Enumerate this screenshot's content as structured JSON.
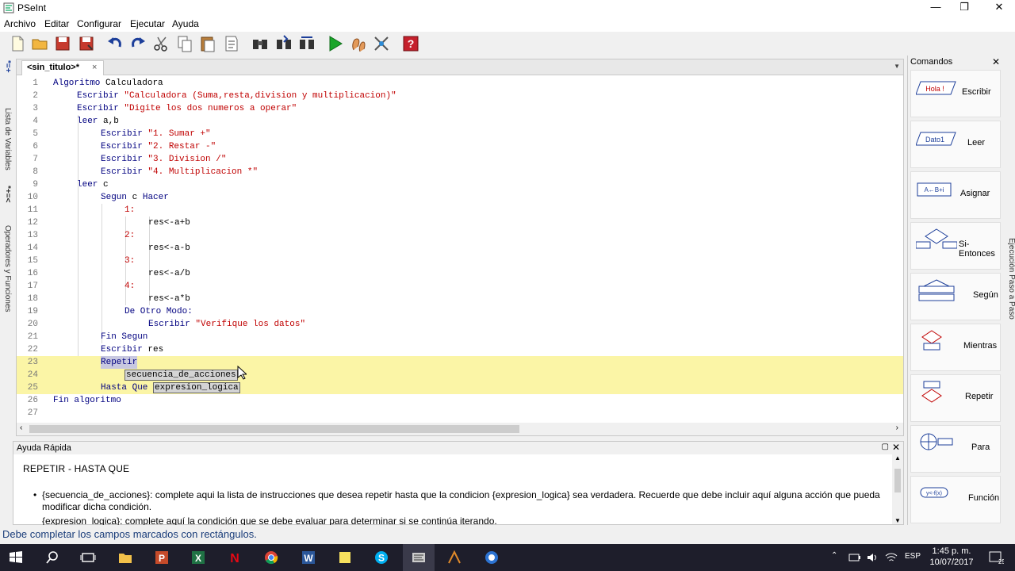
{
  "window": {
    "title": "PSeInt"
  },
  "menu": [
    "Archivo",
    "Editar",
    "Configurar",
    "Ejecutar",
    "Ayuda"
  ],
  "left_tabs": {
    "variables": "Lista de Variables",
    "operators": "Operadores y Funciones",
    "icons_top": "*=+",
    "icons_mid": "*+=<"
  },
  "editor": {
    "tab_label": "<sin_titulo>*",
    "tab_close": "×",
    "lines": [
      {
        "n": "1",
        "text": "Algoritmo Calculadora"
      },
      {
        "n": "2",
        "text": "Escribir \"Calculadora (Suma,resta,division y multiplicacion)\""
      },
      {
        "n": "3",
        "text": "Escribir \"Digite los dos numeros a operar\""
      },
      {
        "n": "4",
        "text": "leer a,b"
      },
      {
        "n": "5",
        "text": "Escribir \"1. Sumar +\""
      },
      {
        "n": "6",
        "text": "Escribir \"2. Restar -\""
      },
      {
        "n": "7",
        "text": "Escribir \"3. Division /\""
      },
      {
        "n": "8",
        "text": "Escribir \"4. Multiplicacion *\""
      },
      {
        "n": "9",
        "text": "leer c"
      },
      {
        "n": "10",
        "text": "Segun c Hacer"
      },
      {
        "n": "11",
        "text": "1:"
      },
      {
        "n": "12",
        "text": "res<-a+b"
      },
      {
        "n": "13",
        "text": "2:"
      },
      {
        "n": "14",
        "text": "res<-a-b"
      },
      {
        "n": "15",
        "text": "3:"
      },
      {
        "n": "16",
        "text": "res<-a/b"
      },
      {
        "n": "17",
        "text": "4:"
      },
      {
        "n": "18",
        "text": "res<-a*b"
      },
      {
        "n": "19",
        "text": "De Otro Modo:"
      },
      {
        "n": "20",
        "text": "Escribir \"Verifique los datos\""
      },
      {
        "n": "21",
        "text": "Fin Segun"
      },
      {
        "n": "22",
        "text": "Escribir res"
      },
      {
        "n": "23",
        "text": "Repetir"
      },
      {
        "n": "24",
        "text": "secuencia_de_acciones"
      },
      {
        "n": "25",
        "text": "Hasta Que expresion_logica"
      },
      {
        "n": "26",
        "text": "Fin algoritmo"
      },
      {
        "n": "27",
        "text": ""
      }
    ],
    "tokens": {
      "l1_kw": "Algoritmo",
      "l1_id": "Calculadora",
      "l2_kw": "Escribir",
      "l2_str": "\"Calculadora (Suma,resta,division y multiplicacion)\"",
      "l3_kw": "Escribir",
      "l3_str": "\"Digite los dos numeros a operar\"",
      "l4_kw": "leer",
      "l4_id": "a,b",
      "l5_kw": "Escribir",
      "l5_str": "\"1. Sumar +\"",
      "l6_kw": "Escribir",
      "l6_str": "\"2. Restar -\"",
      "l7_kw": "Escribir",
      "l7_str": "\"3. Division /\"",
      "l8_kw": "Escribir",
      "l8_str": "\"4. Multiplicacion *\"",
      "l9_kw": "leer",
      "l9_id": "c",
      "l10_kw1": "Segun",
      "l10_id": "c",
      "l10_kw2": "Hacer",
      "l11": "1:",
      "l12": "res<-a+b",
      "l13": "2:",
      "l14": "res<-a-b",
      "l15": "3:",
      "l16": "res<-a/b",
      "l17": "4:",
      "l18": "res<-a*b",
      "l19_kw": "De Otro Modo:",
      "l20_kw": "Escribir",
      "l20_str": "\"Verifique los datos\"",
      "l21_kw": "Fin Segun",
      "l22_kw": "Escribir",
      "l22_id": "res",
      "l23_kw": "Repetir",
      "l24_ph": "secuencia_de_acciones",
      "l25_kw": "Hasta Que",
      "l25_ph": "expresion_logica",
      "l26_kw": "Fin algoritmo"
    }
  },
  "help": {
    "header": "Ayuda Rápida",
    "title": "REPETIR - HASTA QUE",
    "bullets": [
      "{secuencia_de_acciones}: complete aqui la lista de instrucciones que desea repetir hasta que la condicion {expresion_logica} sea verdadera. Recuerde que debe incluir aquí alguna acción que pueda modificar dicha condición.",
      "{expresion_logica}: complete aquí la condición que se debe evaluar para determinar si se continúa iterando."
    ]
  },
  "commands": {
    "header": "Comandos",
    "close": "✕",
    "items": [
      {
        "label": "Escribir",
        "glyph": "Hola !"
      },
      {
        "label": "Leer",
        "glyph": "Dato1"
      },
      {
        "label": "Asignar",
        "glyph": "A←B+i"
      },
      {
        "label": "Si-Entonces",
        "glyph": ""
      },
      {
        "label": "Según",
        "glyph": ""
      },
      {
        "label": "Mientras",
        "glyph": ""
      },
      {
        "label": "Repetir",
        "glyph": ""
      },
      {
        "label": "Para",
        "glyph": ""
      },
      {
        "label": "Función",
        "glyph": "y<-f(x)"
      }
    ]
  },
  "right_tab": "Ejecución Paso a Paso",
  "status": "Debe completar los campos marcados con rectángulos.",
  "taskbar": {
    "time": "1:45 p. m.",
    "date": "10/07/2017",
    "lang": "ESP",
    "badge": "25"
  },
  "colors": {
    "keyword": "#000080",
    "string": "#c00000",
    "highlight": "#fbf5a6",
    "status_text": "#1a3d7a",
    "taskbar": "#1e1e2b"
  }
}
